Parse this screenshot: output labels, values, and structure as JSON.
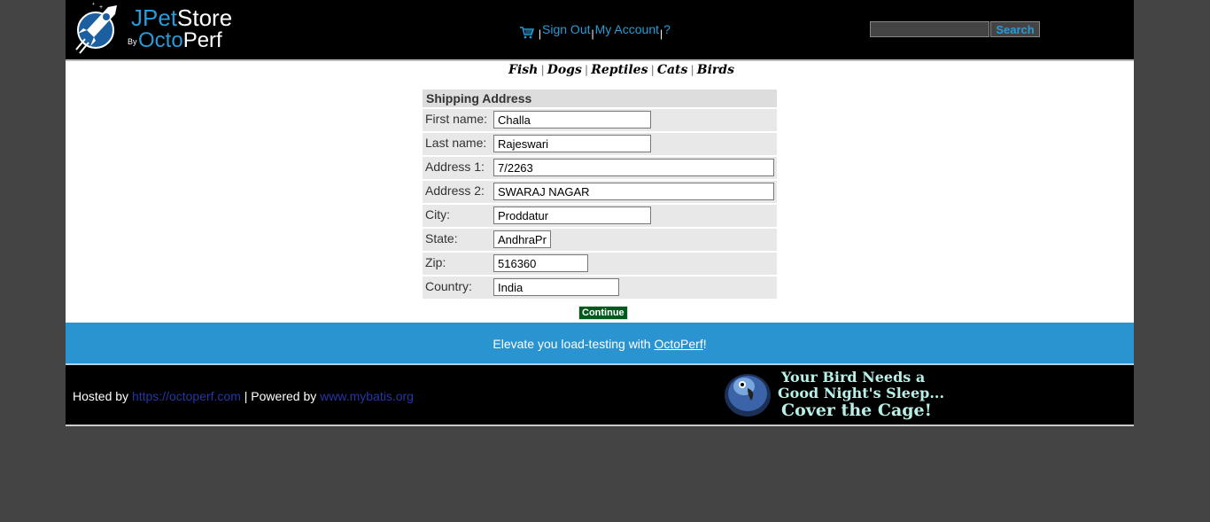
{
  "header": {
    "logo": {
      "brand_a": "JPet",
      "brand_b": "Store",
      "by": "By",
      "brand_c": "Octo",
      "brand_d": "Perf"
    },
    "menu": {
      "sign_out": "Sign Out",
      "my_account": "My Account",
      "help": "?",
      "separator": "|"
    },
    "search": {
      "value": "",
      "button": "Search"
    }
  },
  "quicklinks": [
    "Fish",
    "Dogs",
    "Reptiles",
    "Cats",
    "Birds"
  ],
  "form": {
    "title": "Shipping Address",
    "fields": [
      {
        "label": "First name:",
        "value": "Challa"
      },
      {
        "label": "Last name:",
        "value": "Rajeswari"
      },
      {
        "label": "Address 1:",
        "value": "7/2263"
      },
      {
        "label": "Address 2:",
        "value": "SWARAJ NAGAR"
      },
      {
        "label": "City:",
        "value": "Proddatur"
      },
      {
        "label": "State:",
        "value": "AndhraPradesh"
      },
      {
        "label": "Zip:",
        "value": "516360"
      },
      {
        "label": "Country:",
        "value": "India"
      }
    ],
    "continue": "Continue"
  },
  "poweredby": {
    "prefix": "Elevate you load-testing with ",
    "link": "OctoPerf",
    "suffix": "!"
  },
  "footer": {
    "hosted_label": "Hosted by ",
    "hosted_link": "https://octoperf.com",
    "powered_label": " | Powered by ",
    "powered_link": "www.mybatis.org",
    "banner": {
      "line1": "Your Bird Needs a",
      "line2": "Good Night's Sleep...",
      "line3": "Cover the Cage!"
    }
  },
  "colors": {
    "accent": "#2a94d0",
    "continue_bg": "#005a1e",
    "page_bg": "#444444"
  }
}
